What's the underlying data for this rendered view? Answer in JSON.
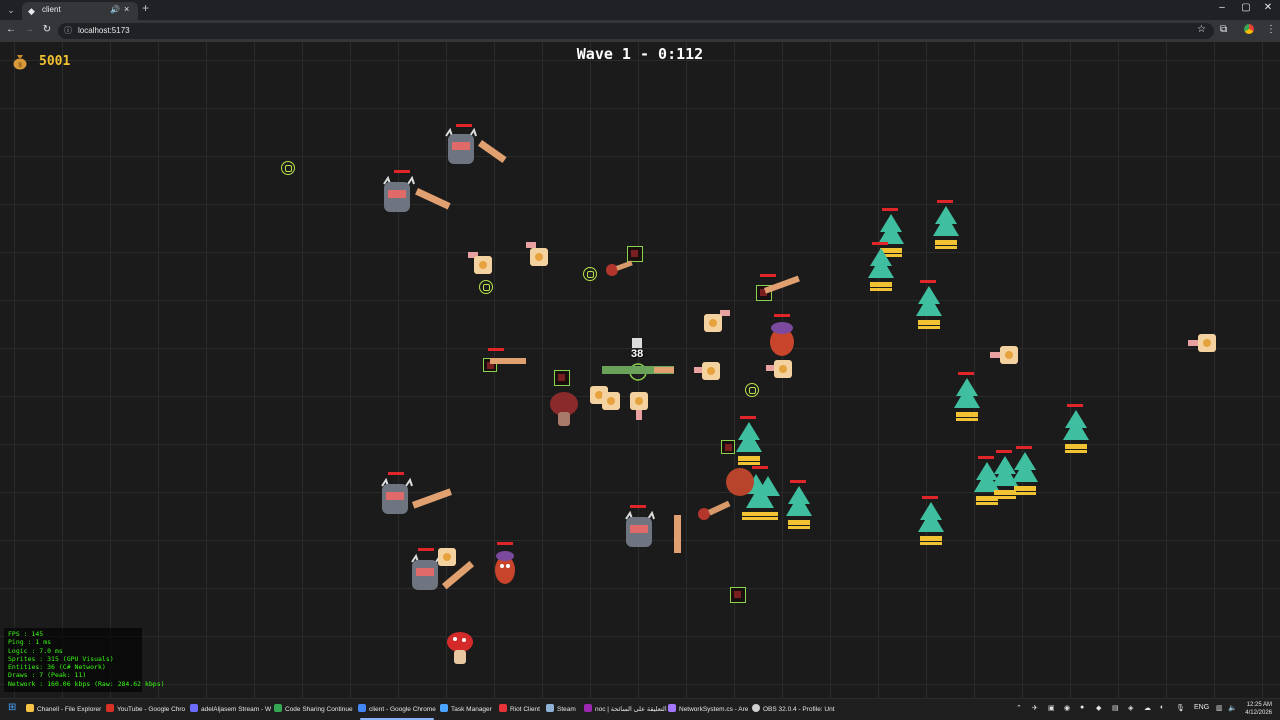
{
  "browser": {
    "tab_title": "client",
    "url": "localhost:5173",
    "new_tab_label": "+",
    "window_controls": [
      "–",
      "▢",
      "✕"
    ]
  },
  "hud": {
    "gold_value": "5001",
    "gold_icon": "money-bag-icon",
    "wave_text": "Wave 1 - 0:112"
  },
  "floating_text": {
    "damage_number": "38"
  },
  "stats": {
    "lines": [
      "FPS    : 145",
      "Ping   : 1 ms",
      "Logic  : 7.0 ms",
      "Sprites : 315 (GPU Visuals)",
      "Entities: 36 (C# Network)",
      "Draws   : 7 (Peak: 11)",
      "Network : 160.06 kbps (Raw: 284.62 kbps)"
    ]
  },
  "taskbar": {
    "items": [
      {
        "label": "Chanell - File Explorer",
        "color": "#f6c343"
      },
      {
        "label": "YouTube - Google Chro",
        "color": "#d93025"
      },
      {
        "label": "adelAljasem Stream - W",
        "color": "#6c6cff"
      },
      {
        "label": "Code Sharing Continue",
        "color": "#34a853"
      },
      {
        "label": "client - Google Chrome",
        "color": "#4285f4"
      },
      {
        "label": "Task Manager",
        "color": "#4aa3ff"
      },
      {
        "label": "Riot Client",
        "color": "#e8333a"
      },
      {
        "label": "Steam",
        "color": "#8fb2d6"
      },
      {
        "label": "noc | التعليقة على السائحة",
        "color": "#9c27b0"
      },
      {
        "label": "NetworkSystem.cs - Are",
        "color": "#a477ff"
      },
      {
        "label": "OBS 32.0.4 - Profile: Unt",
        "color": "#cfcfcf"
      }
    ],
    "lang": "ENG",
    "time": "12:25 AM",
    "date": "4/12/2026"
  },
  "colors": {
    "gold": "#f1c232",
    "stats_text": "#39ff14",
    "health_bar": "#e0262b",
    "pickup_ring": "#b8e34b"
  }
}
